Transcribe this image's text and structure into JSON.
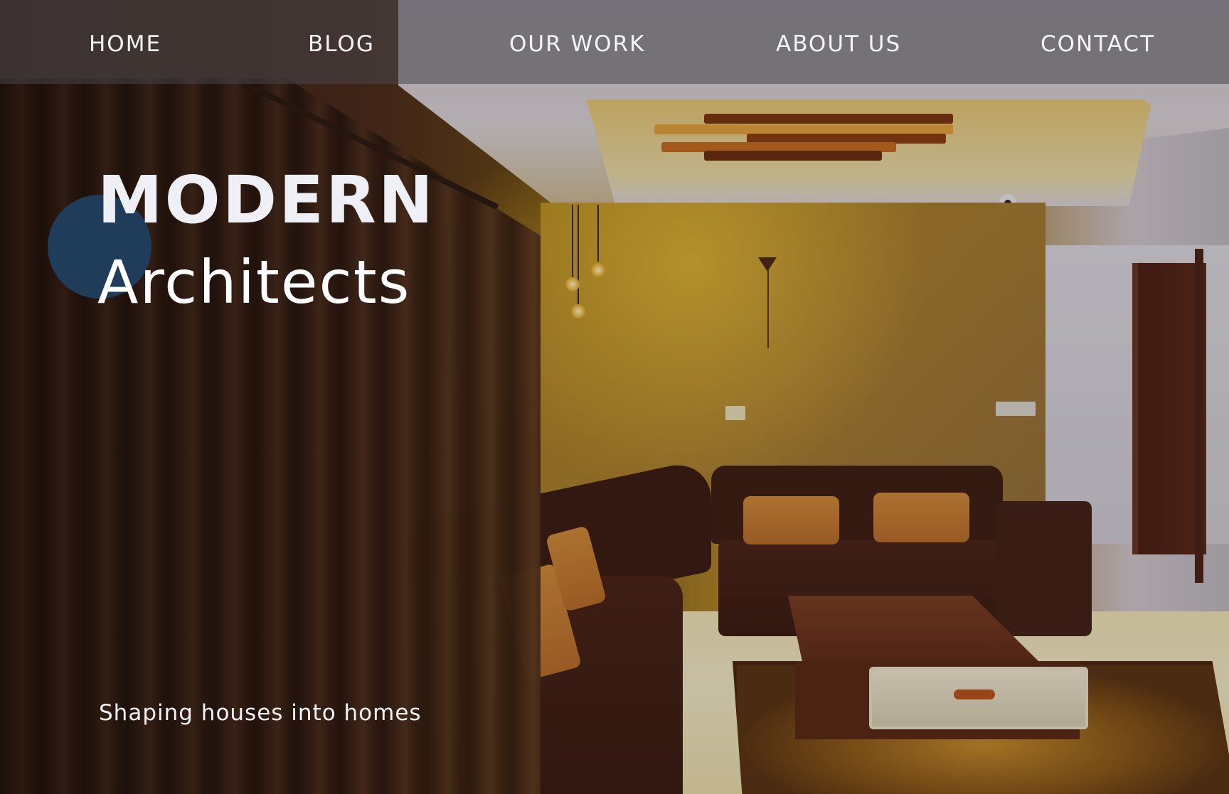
{
  "nav": {
    "items": [
      {
        "label": "HOME"
      },
      {
        "label": "BLOG"
      },
      {
        "label": "OUR WORK"
      },
      {
        "label": "ABOUT US"
      },
      {
        "label": "CONTACT"
      }
    ]
  },
  "hero": {
    "title_line1": "MODERN",
    "title_line2": "Architects",
    "tagline": "Shaping houses into homes"
  },
  "colors": {
    "accent_dot": "#1f3c5a",
    "title_primary": "#eef0f6",
    "nav_text": "#f4f4f6"
  }
}
